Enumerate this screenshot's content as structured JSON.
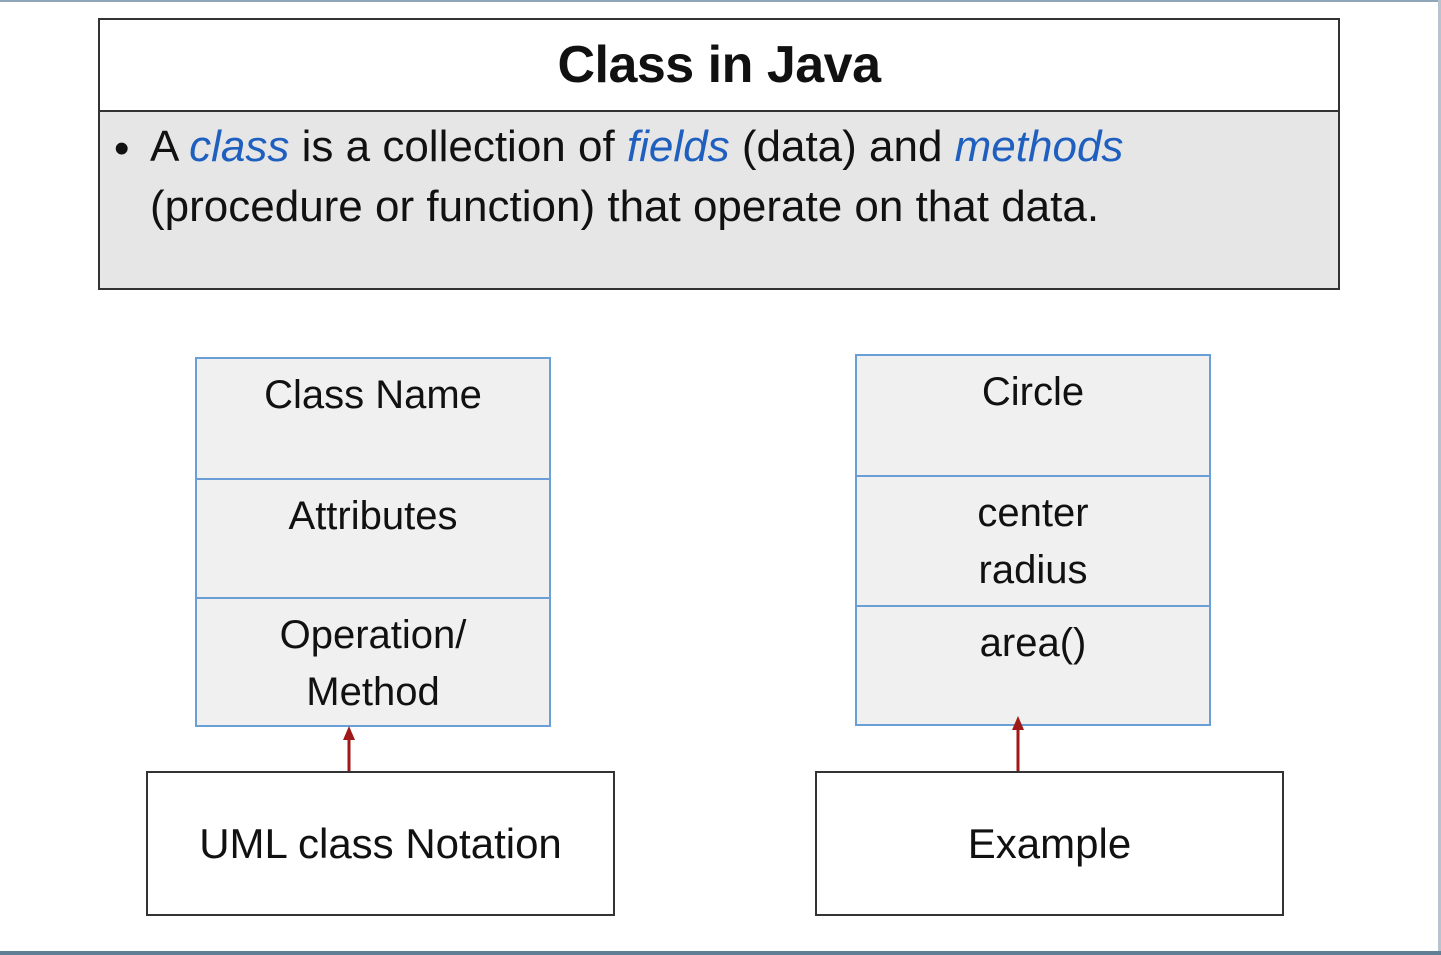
{
  "title": "Class in Java",
  "definition": {
    "bullet": "•",
    "line1": [
      {
        "text": "A ",
        "emphasis": false
      },
      {
        "text": "class",
        "emphasis": true
      },
      {
        "text": " is a collection of ",
        "emphasis": false
      },
      {
        "text": "fields",
        "emphasis": true
      },
      {
        "text": " (data) and ",
        "emphasis": false
      },
      {
        "text": "methods",
        "emphasis": true
      }
    ],
    "line2": "(procedure or function) that operate on that data."
  },
  "uml_notation": {
    "class_name": "Class Name",
    "attributes": "Attributes",
    "operation_line1": "Operation/",
    "operation_line2": "Method",
    "label": "UML class Notation"
  },
  "example": {
    "class_name": "Circle",
    "attribute1": "center",
    "attribute2": "radius",
    "method": "area()",
    "label": "Example"
  },
  "colors": {
    "emphasis": "#1f5fbf",
    "uml_border": "#6a9ed6",
    "uml_fill": "#f0f0f0",
    "definition_fill": "#e6e6e6",
    "arrow": "#a01818"
  }
}
